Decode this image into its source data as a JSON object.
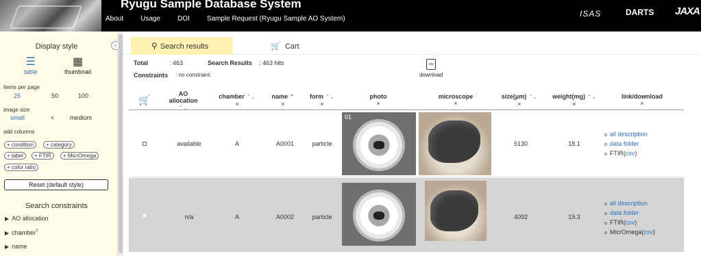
{
  "header": {
    "title": "Ryugu Sample Database System",
    "nav": [
      "About",
      "Usage",
      "DOI",
      "Sample Request (Ryugu Sample AO System)"
    ],
    "logos": [
      "ISAS",
      "DARTS",
      "JAXA"
    ]
  },
  "sidebar": {
    "display_style_title": "Display style",
    "style_options": [
      {
        "label": "table",
        "icon": "list-icon",
        "selected": true
      },
      {
        "label": "thumbnail",
        "icon": "grid-icon",
        "selected": false
      }
    ],
    "items_per_page_label": "items per page",
    "items_per_page_options": [
      "25",
      "50",
      "100"
    ],
    "image_size_label": "image size",
    "image_size_options": [
      "small",
      "<",
      "medium"
    ],
    "add_columns_label": "add columns",
    "add_columns": [
      "+ condition",
      "+ category",
      "+ label",
      "+ FTIR",
      "+ MicrOmega",
      "+ color ratio"
    ],
    "reset_label": "Reset (default style)",
    "search_constraints_title": "Search constraints",
    "constraints": [
      "AO allocation",
      "chamber",
      "name"
    ]
  },
  "main": {
    "tabs": [
      {
        "label": "Search results",
        "icon": "search-icon",
        "active": true
      },
      {
        "label": "Cart",
        "icon": "cart-icon",
        "active": false
      }
    ],
    "total_label": "Total",
    "total_value": ": 463",
    "search_results_label": "Search Results",
    "search_results_value": ":  463 hits",
    "constraints_label": "Constraints",
    "constraints_value": ": no constraint.",
    "download_icon_text": "csv",
    "download_label": "download",
    "columns": [
      {
        "label": "AO allocation",
        "x": "×"
      },
      {
        "label": "chamber",
        "x": "×"
      },
      {
        "label": "name",
        "x": "×"
      },
      {
        "label": "form",
        "x": "×"
      },
      {
        "label": "photo",
        "x": "×"
      },
      {
        "label": "microscope",
        "x": "×"
      },
      {
        "label": "size(μm)",
        "x": "×"
      },
      {
        "label": "weight(mg)",
        "x": "×"
      },
      {
        "label": "link/download",
        "x": "×"
      }
    ],
    "rows": [
      {
        "ao_allocation": "available",
        "chamber": "A",
        "name": "A0001",
        "form": "particle",
        "photo_label": "01",
        "size": "5130",
        "weight": "18.1",
        "links": [
          {
            "text": "all description"
          },
          {
            "text": "data folder"
          },
          {
            "prefix": "FTIR(",
            "link": "csv",
            "suffix": ")"
          }
        ]
      },
      {
        "ao_allocation": "n/a",
        "chamber": "A",
        "name": "A0002",
        "form": "particle",
        "photo_label": "",
        "size": "4092",
        "weight": "19.3",
        "links": [
          {
            "text": "all description"
          },
          {
            "text": "data folder"
          },
          {
            "prefix": "FTIR(",
            "link": "csv",
            "suffix": ")"
          },
          {
            "prefix": "MicrOmega(",
            "link": "csv",
            "suffix": ")"
          }
        ]
      }
    ]
  }
}
